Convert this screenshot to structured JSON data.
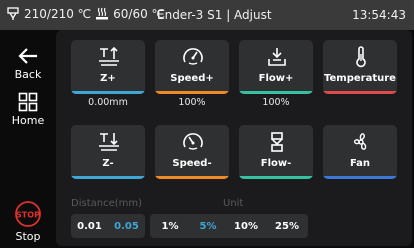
{
  "status": {
    "nozzle_temp": "210/210 ℃",
    "bed_temp": "60/60 ℃",
    "title": "Ender-3 S1 | Adjust",
    "time": "13:54:43"
  },
  "sidebar": {
    "back_label": "Back",
    "home_label": "Home",
    "stop_badge": "STOP",
    "stop_label": "Stop"
  },
  "tiles": {
    "z_up": {
      "label": "Z+",
      "value": "0.00mm",
      "color": "#3fa7d6"
    },
    "speed_up": {
      "label": "Speed+",
      "value": "100%",
      "color": "#f08a24"
    },
    "flow_up": {
      "label": "Flow+",
      "value": "100%",
      "color": "#35c2a0"
    },
    "temperature": {
      "label": "Temperature",
      "color": "#e04a4a"
    },
    "z_down": {
      "label": "Z-",
      "color": "#3fa7d6"
    },
    "speed_down": {
      "label": "Speed-",
      "color": "#f08a24"
    },
    "flow_down": {
      "label": "Flow-",
      "color": "#35c2a0"
    },
    "fan": {
      "label": "Fan",
      "color": "#3b78d8"
    }
  },
  "distance": {
    "label": "Distance(mm)",
    "options": [
      "0.01",
      "0.05"
    ],
    "selected": "0.05"
  },
  "unit": {
    "label": "Unit",
    "options": [
      "1%",
      "5%",
      "10%",
      "25%"
    ],
    "selected": "5%"
  },
  "colors": {
    "accent": "#3fa7d6",
    "stop": "#e0302a"
  }
}
